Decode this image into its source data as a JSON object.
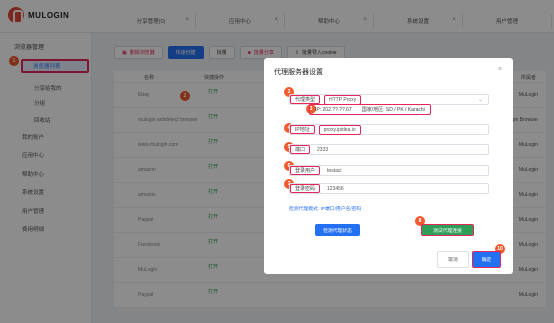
{
  "app": {
    "logo_text": "MULOGIN"
  },
  "topnav": [
    "分享管理(0)",
    "应用中心",
    "帮助中心",
    "系统设置",
    "用户管理"
  ],
  "sidebar": {
    "group": "浏览器管理",
    "items": [
      {
        "label": "浏览器列表",
        "active": true
      },
      {
        "label": "分享给我的"
      },
      {
        "label": "分组"
      },
      {
        "label": "回收站"
      },
      {
        "label": "我的账户"
      },
      {
        "label": "应用中心"
      },
      {
        "label": "帮助中心"
      },
      {
        "label": "系统设置"
      },
      {
        "label": "用户管理"
      },
      {
        "label": "费用明细"
      }
    ]
  },
  "toolbar": {
    "delete": "删除浏览器",
    "create": "快速创建",
    "batch": "批量",
    "block": "批量分享",
    "import": "批量导入cookie"
  },
  "table": {
    "headers": [
      "名称",
      "快捷操作",
      "备注",
      "所属者"
    ],
    "rows": [
      {
        "site": "Ebay",
        "owner": "MuLogin"
      },
      {
        "site": "mulogin antidetect browser",
        "owner": "MuLogin Browser"
      },
      {
        "site": "www.mulogin.com",
        "owner": "MuLogin"
      },
      {
        "site": "amazon",
        "owner": "MuLogin"
      },
      {
        "site": "amazon",
        "owner": "MuLogin"
      },
      {
        "site": "Paypal",
        "owner": "MuLogin"
      },
      {
        "site": "Facebook",
        "owner": "MuLogin"
      },
      {
        "site": "MuLogin",
        "owner": "MuLogin"
      },
      {
        "site": "Paypal",
        "owner": "MuLogin"
      }
    ],
    "open_label": "打开"
  },
  "modal": {
    "title": "代理服务器设置",
    "proxy_type_label": "代理类型",
    "proxy_type_value": "HTTP Proxy",
    "ip_line": "IP: 202.??.??.67",
    "region": "国家/地区: SD / PK / Karachi",
    "ip_label": "IP地址",
    "ip_value": "proxy.ipidea.io",
    "port_label": "端口",
    "port_value": "2333",
    "user_label": "登录用户",
    "user_value": "testaci",
    "pass_label": "登录密码",
    "pass_value": "123456",
    "hint": "检测代理模式: IP端口/用户名/密码",
    "check_btn": "检测代理状态",
    "test_btn": "测试代理连接",
    "cancel": "取消",
    "ok": "确定"
  },
  "steps": [
    "1",
    "2",
    "3",
    "3",
    "4",
    "5",
    "6",
    "7",
    "8",
    "9",
    "10"
  ],
  "colors": {
    "accent": "#2470f2",
    "highlight": "#e4265a",
    "badge": "#ef5a2f",
    "green": "#2f9e58"
  }
}
